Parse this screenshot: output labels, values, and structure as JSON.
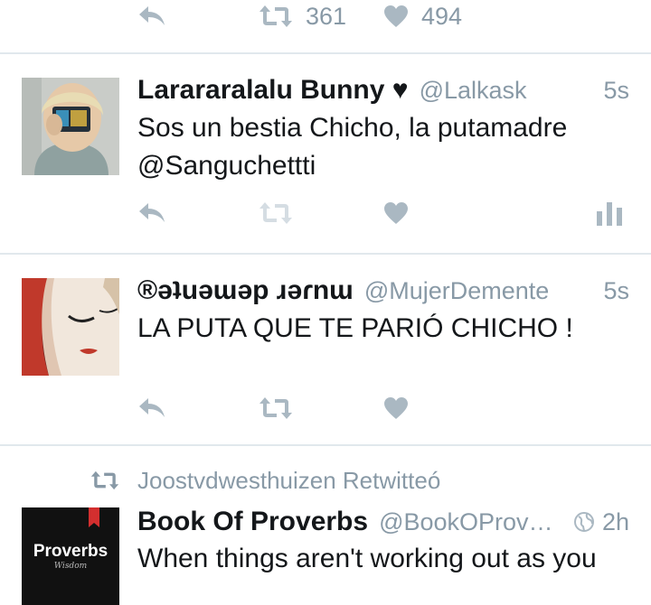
{
  "top_actions": {
    "retweet_count": "361",
    "like_count": "494"
  },
  "tweets": [
    {
      "name": "Larararalalu Bunny ♥",
      "handle": "@Lalkask",
      "time": "5s",
      "text": "Sos un bestia Chicho,  la putamadre @Sanguchettti"
    },
    {
      "name": "®ǝʇuǝɯǝp ɹǝɾnɯ",
      "handle": "@MujerDemente",
      "time": "5s",
      "text": "LA PUTA QUE TE PARIÓ CHICHO !"
    },
    {
      "retweeted_by": "Joostvdwesthuizen Retwitteó",
      "name": "Book Of Proverbs",
      "handle": "@BookOProver...",
      "time": "2h",
      "text": "When things aren't working out as you",
      "avatar_text": "Proverbs",
      "avatar_subtext": "Wisdom"
    }
  ],
  "colors": {
    "icon": "#aab8c2",
    "meta": "#8899a6",
    "divider": "#e1e8ed",
    "avatar_bookmark": "#d32f2f"
  }
}
